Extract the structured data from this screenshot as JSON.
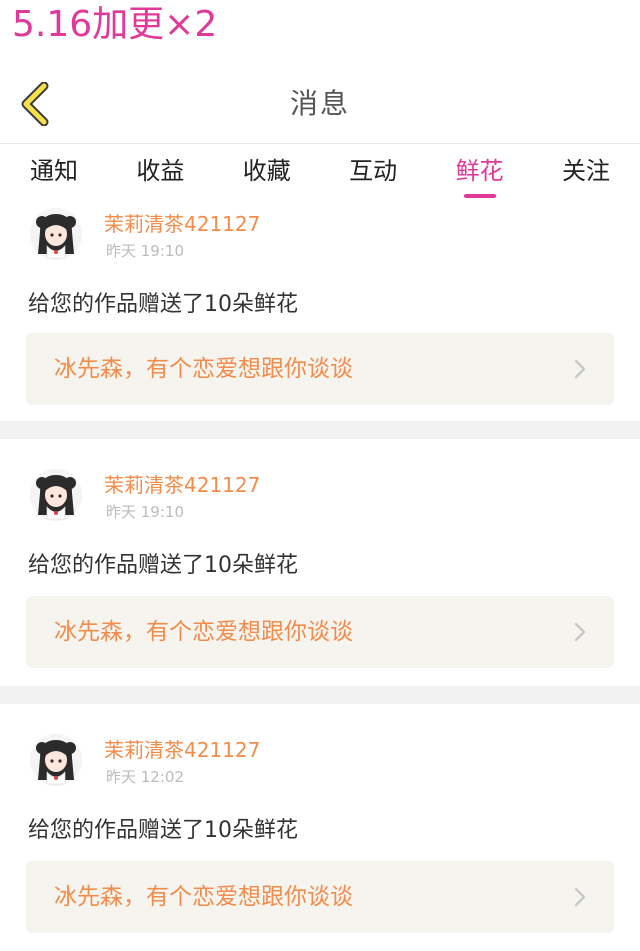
{
  "overlay": {
    "title": "5.16加更×2"
  },
  "header": {
    "title": "消息"
  },
  "tabs": [
    {
      "label": "通知"
    },
    {
      "label": "收益"
    },
    {
      "label": "收藏"
    },
    {
      "label": "互动"
    },
    {
      "label": "鲜花"
    },
    {
      "label": "关注"
    }
  ],
  "active_tab": "鲜花",
  "colors": {
    "accent": "#e0399a",
    "username": "#f28c4b",
    "card_link_bg": "#f6f4ef"
  },
  "messages": [
    {
      "user": "茉莉清茶421127",
      "time": "昨天 19:10",
      "text": "给您的作品赠送了10朵鲜花",
      "work": "冰先森，有个恋爱想跟你谈谈"
    },
    {
      "user": "茉莉清茶421127",
      "time": "昨天 19:10",
      "text": "给您的作品赠送了10朵鲜花",
      "work": "冰先森，有个恋爱想跟你谈谈"
    },
    {
      "user": "茉莉清茶421127",
      "time": "昨天 12:02",
      "text": "给您的作品赠送了10朵鲜花",
      "work": "冰先森，有个恋爱想跟你谈谈"
    }
  ]
}
